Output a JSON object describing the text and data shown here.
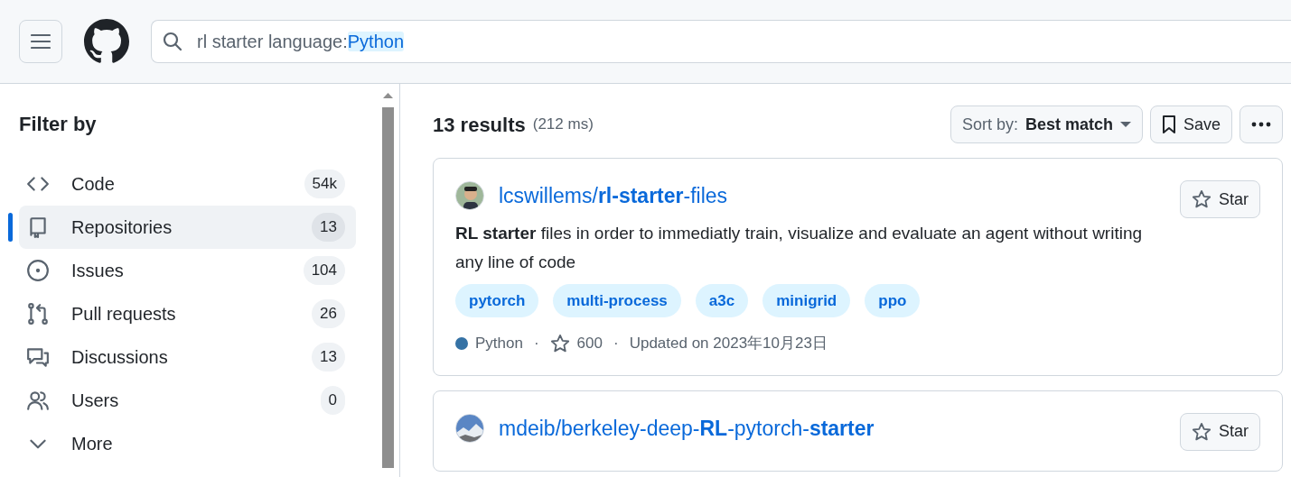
{
  "header": {
    "search": {
      "query": "rl starter language:",
      "qualifier": "Python"
    }
  },
  "sidebar": {
    "title": "Filter by",
    "items": [
      {
        "label": "Code",
        "count": "54k",
        "kind": "code",
        "selected": false
      },
      {
        "label": "Repositories",
        "count": "13",
        "kind": "repo",
        "selected": true
      },
      {
        "label": "Issues",
        "count": "104",
        "kind": "issue",
        "selected": false
      },
      {
        "label": "Pull requests",
        "count": "26",
        "kind": "pr",
        "selected": false
      },
      {
        "label": "Discussions",
        "count": "13",
        "kind": "discussion",
        "selected": false
      },
      {
        "label": "Users",
        "count": "0",
        "kind": "users",
        "selected": false
      },
      {
        "label": "More",
        "kind": "chevron",
        "selected": false
      }
    ]
  },
  "results": {
    "count": "13 results",
    "time": "(212 ms)",
    "sort_label": "Sort by:",
    "sort_value": "Best match",
    "save": "Save",
    "repos": [
      {
        "name": "lcswillems/**rl-starter**-files",
        "description": "**RL starter** files in order to immediatly train, visualize and evaluate an agent without writing any line of code",
        "topics": [
          "pytorch",
          "multi-process",
          "a3c",
          "minigrid",
          "ppo"
        ],
        "language": "Python",
        "color": "#3572a5",
        "separator_1": "·",
        "stars": "600",
        "separator_2": "·",
        "updated": "Updated on 2023年10月23日",
        "star_button": "Star"
      },
      {
        "name": "mdeib/berkeley-deep-**RL**-pytorch-**starter**",
        "star_button": "Star"
      }
    ]
  }
}
